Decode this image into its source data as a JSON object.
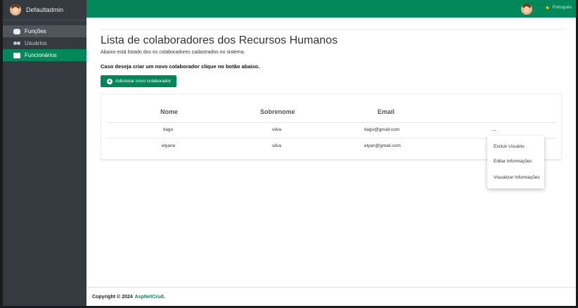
{
  "sidebar": {
    "user_name": "Defaultadmin",
    "items": [
      {
        "label": "Funções",
        "icon": "masks-icon"
      },
      {
        "label": "Usuários",
        "icon": "users-icon"
      },
      {
        "label": "Funcionários",
        "icon": "briefcase-icon"
      }
    ]
  },
  "topbar": {
    "language": "Português",
    "accent": "#00875a"
  },
  "main": {
    "title": "Lista de colaboradores dos Recursos Humanos",
    "subtitle": "Abaixo está listado dos os colaboradores cadastrados no sistema.",
    "hint": "Caso deseja criar um novo colaborador clique no botão abaixo.",
    "add_button": "Adicionar novo colaborador",
    "table": {
      "columns": [
        "Nome",
        "Sobrenome",
        "Email"
      ],
      "rows": [
        {
          "nome": "tiago",
          "sobrenome": "silva",
          "email": "tiago@gmail.com",
          "actions": "..."
        },
        {
          "nome": "elyane",
          "sobrenome": "silva",
          "email": "elyan@gmail.com",
          "actions": ""
        }
      ]
    },
    "dropdown": [
      "Excluir Usuário",
      "Editar Informações",
      "Visualizar Informações"
    ]
  },
  "footer": {
    "copyright": "Copyright © 2024",
    "brand": "AspNetCrud",
    "suffix": "."
  }
}
